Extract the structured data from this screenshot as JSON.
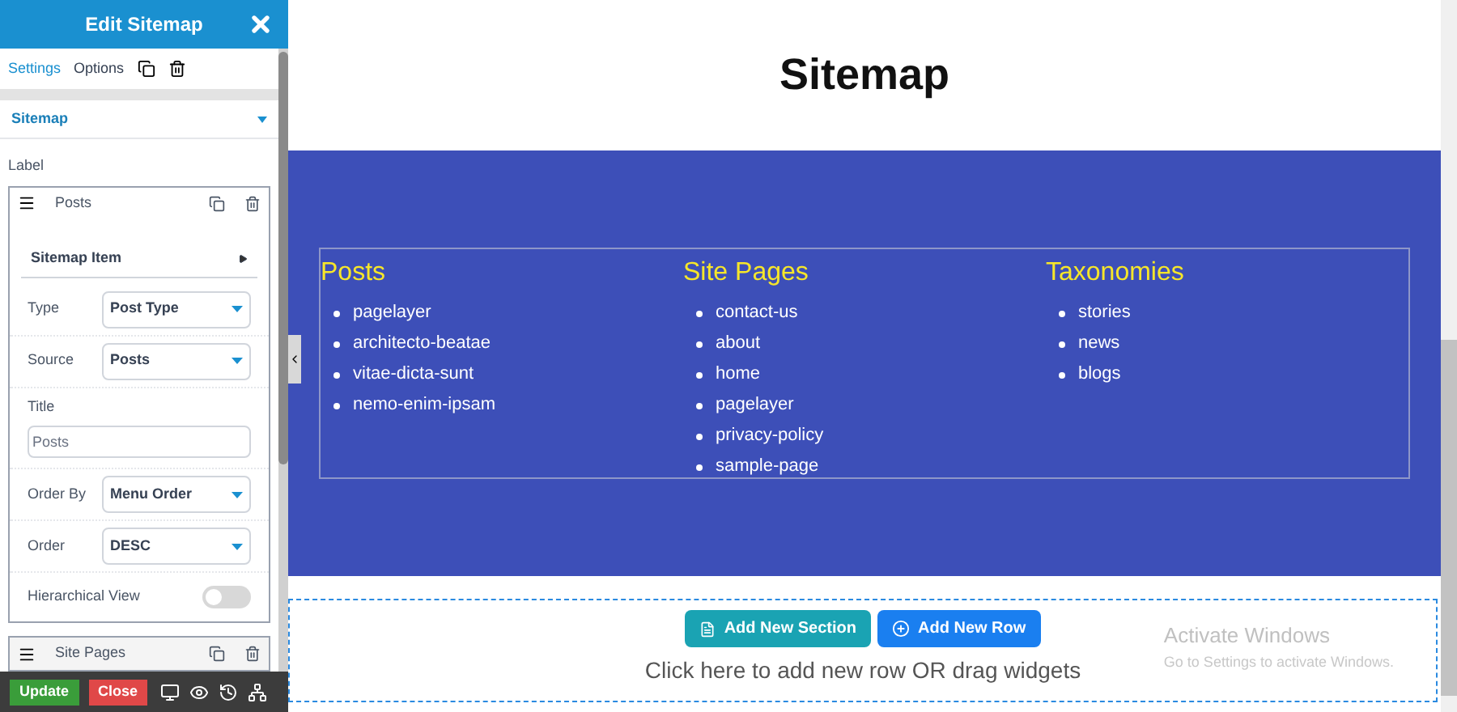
{
  "panel": {
    "title": "Edit Sitemap",
    "tabs": [
      {
        "label": "Settings",
        "selected": true
      },
      {
        "label": "Options",
        "selected": false
      }
    ],
    "section": {
      "title": "Sitemap",
      "expanded": true
    },
    "label": "Label",
    "items": [
      {
        "title": "Posts",
        "expanded": true,
        "group": "Sitemap Item",
        "fields": [
          {
            "kind": "select",
            "label": "Type",
            "value": "Post Type"
          },
          {
            "kind": "select",
            "label": "Source",
            "value": "Posts"
          },
          {
            "kind": "text",
            "label": "Title",
            "placeholder": "Posts"
          },
          {
            "kind": "select",
            "label": "Order By",
            "value": "Menu Order"
          },
          {
            "kind": "select",
            "label": "Order",
            "value": "DESC"
          },
          {
            "kind": "toggle",
            "label": "Hierarchical View",
            "on": false
          }
        ]
      },
      {
        "title": "Site Pages",
        "expanded": false
      }
    ],
    "buttons": [
      {
        "label": "Update",
        "kind": "update"
      },
      {
        "label": "Close",
        "kind": "close"
      }
    ]
  },
  "page": {
    "title": "Sitemap",
    "columns": [
      {
        "heading": "Posts",
        "links": [
          "pagelayer",
          "architecto-beatae",
          "vitae-dicta-sunt",
          "nemo-enim-ipsam"
        ]
      },
      {
        "heading": "Site Pages",
        "links": [
          "contact-us",
          "about",
          "home",
          "pagelayer",
          "privacy-policy",
          "sample-page"
        ]
      },
      {
        "heading": "Taxonomies",
        "links": [
          "stories",
          "news",
          "blogs"
        ]
      }
    ],
    "add_buttons": [
      {
        "label": "Add New Section",
        "kind": "section"
      },
      {
        "label": "Add New Row",
        "kind": "row"
      }
    ],
    "hint": "Click here to add new row OR drag widgets"
  },
  "activation": {
    "title": "Activate Windows",
    "text": "Go to Settings to activate Windows."
  }
}
